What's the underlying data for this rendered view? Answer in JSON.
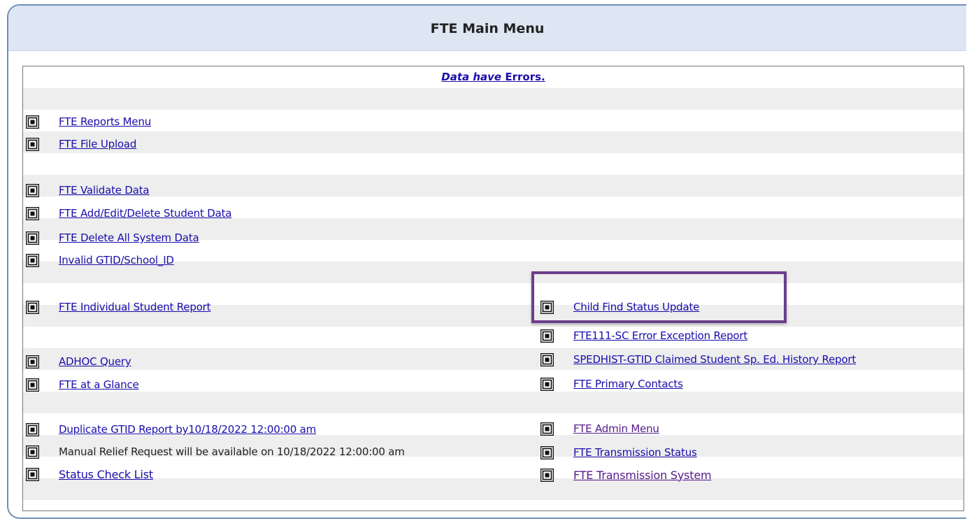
{
  "title": "FTE Main Menu",
  "errors_notice": {
    "italic": "Data have",
    "rest": "Errors."
  },
  "left_items": [
    {
      "label": "FTE Reports Menu",
      "icon": "menu-square-icon"
    },
    {
      "label": "FTE File Upload",
      "icon": "menu-square-icon"
    },
    {
      "label": "FTE Validate Data",
      "icon": "menu-square-icon"
    },
    {
      "label": "FTE Add/Edit/Delete Student Data",
      "icon": "menu-square-icon"
    },
    {
      "label": "FTE Delete All System Data",
      "icon": "menu-square-icon"
    },
    {
      "label": "Invalid GTID/School_ID",
      "icon": "menu-square-icon"
    },
    {
      "label": "FTE Individual Student Report",
      "icon": "menu-square-icon"
    },
    {
      "label": "ADHOC Query",
      "icon": "menu-square-icon"
    },
    {
      "label": "FTE at a Glance",
      "icon": "menu-square-icon"
    },
    {
      "label": "Duplicate GTID Report by10/18/2022 12:00:00 am",
      "icon": "menu-square-icon"
    },
    {
      "label": "Manual Relief Request will be available on 10/18/2022 12:00:00 am",
      "icon": "menu-square-icon"
    },
    {
      "label": "Status Check List",
      "icon": "menu-square-icon"
    }
  ],
  "right_items": [
    {
      "label": "Child Find Status Update",
      "icon": "menu-square-icon"
    },
    {
      "label": "FTE111-SC Error Exception Report",
      "icon": "menu-square-icon"
    },
    {
      "label": "SPEDHIST-GTID Claimed Student Sp. Ed. History Report",
      "icon": "menu-square-icon"
    },
    {
      "label": "FTE Primary Contacts",
      "icon": "menu-square-icon"
    },
    {
      "label": "FTE Admin Menu",
      "icon": "menu-square-icon"
    },
    {
      "label": "FTE Transmission Status",
      "icon": "menu-square-icon"
    },
    {
      "label": "FTE Transmission System",
      "icon": "menu-square-icon"
    }
  ],
  "colors": {
    "link": "#1a0dab",
    "visited": "#551a8b",
    "header_bg": "#dde6f2",
    "highlight": "#6b3e8a",
    "row_alt": "#eeeeee"
  }
}
